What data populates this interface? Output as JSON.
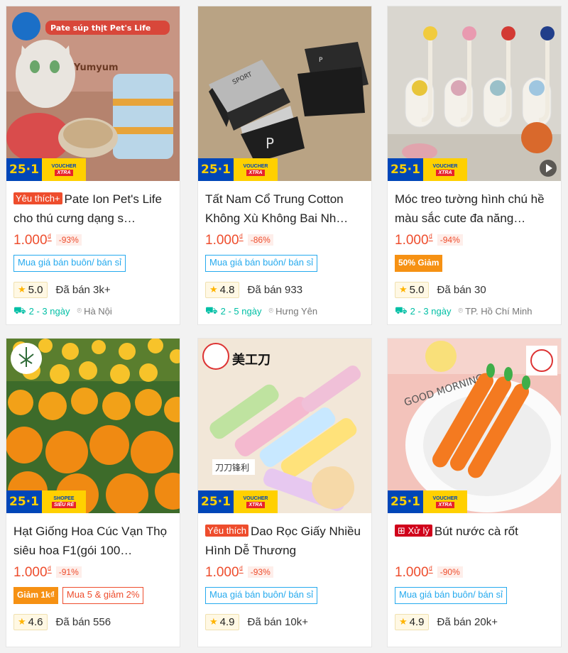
{
  "products": [
    {
      "id": "p1",
      "image_desc": "cat food pate cans",
      "image_text": [
        "Pate súp thịt Pet's Life",
        "Yumyum"
      ],
      "promo_badge": {
        "number": "25·1",
        "label": "VOUCHER",
        "extra": "XTRA"
      },
      "title_tag": "Yêu thích+",
      "title": "Pate Ion Pet's Life cho thú cưng dạng s…",
      "price": "1.000",
      "currency": "₫",
      "discount": "-93%",
      "tags": [
        {
          "type": "outline",
          "text": "Mua giá bán buôn/ bán sỉ"
        }
      ],
      "rating": "5.0",
      "sold": "Đã bán 3k+",
      "ship_days": "2 - 3 ngày",
      "location": "Hà Nội"
    },
    {
      "id": "p2",
      "image_desc": "folded socks",
      "image_text": [
        "SPORT"
      ],
      "promo_badge": {
        "number": "25·1",
        "label": "VOUCHER",
        "extra": "XTRA"
      },
      "title_tag": "",
      "title": "Tất Nam Cổ Trung Cotton Không Xù Không Bai Nh…",
      "price": "1.000",
      "currency": "₫",
      "discount": "-86%",
      "tags": [
        {
          "type": "outline",
          "text": "Mua giá bán buôn/ bán sỉ"
        }
      ],
      "rating": "4.8",
      "sold": "Đã bán 933",
      "ship_days": "2 - 5 ngày",
      "location": "Hưng Yên"
    },
    {
      "id": "p3",
      "image_desc": "wall hooks",
      "image_text": [],
      "promo_badge": {
        "number": "25·1",
        "label": "VOUCHER",
        "extra": "XTRA"
      },
      "title_tag": "",
      "title": "Móc treo tường hình chú hề màu sắc cute đa năng…",
      "price": "1.000",
      "currency": "₫",
      "discount": "-94%",
      "tags": [
        {
          "type": "orange",
          "text": "50% Giảm"
        }
      ],
      "rating": "5.0",
      "sold": "Đã bán 30",
      "ship_days": "2 - 3 ngày",
      "location": "TP. Hồ Chí Minh",
      "has_video": true
    },
    {
      "id": "p4",
      "image_desc": "marigold flowers",
      "image_text": [],
      "promo_badge": {
        "number": "25·1",
        "label": "SHOPEE",
        "extra": "SIÊU RẺ"
      },
      "title_tag": "",
      "title": "Hạt Giống Hoa Cúc Vạn Thọ siêu hoa F1(gói 100…",
      "price": "1.000",
      "currency": "₫",
      "discount": "-91%",
      "tags": [
        {
          "type": "orange",
          "text": "Giảm 1k₫"
        },
        {
          "type": "red-outline",
          "text": "Mua 5 & giảm 2%"
        }
      ],
      "rating": "4.6",
      "sold": "Đã bán 556",
      "ship_days": "",
      "location": ""
    },
    {
      "id": "p5",
      "image_desc": "cute box cutters",
      "image_text": [
        "美工刀",
        "刀刀锋利"
      ],
      "promo_badge": {
        "number": "25·1",
        "label": "VOUCHER",
        "extra": "XTRA"
      },
      "title_tag": "Yêu thích",
      "title": "Dao Rọc Giấy Nhiều Hình Dễ Thương",
      "price": "1.000",
      "currency": "₫",
      "discount": "-93%",
      "tags": [
        {
          "type": "outline",
          "text": "Mua giá bán buôn/ bán sỉ"
        }
      ],
      "rating": "4.9",
      "sold": "Đã bán 10k+",
      "ship_days": "",
      "location": ""
    },
    {
      "id": "p6",
      "image_desc": "carrot pens",
      "image_text": [
        "GOOD MORNING"
      ],
      "promo_badge": {
        "number": "25·1",
        "label": "VOUCHER",
        "extra": "XTRA"
      },
      "title_tag": "Xử lý",
      "title": "Bút nước cà rốt",
      "price": "1.000",
      "currency": "₫",
      "discount": "-90%",
      "tags": [
        {
          "type": "outline",
          "text": "Mua giá bán buôn/ bán sỉ"
        }
      ],
      "rating": "4.9",
      "sold": "Đã bán 20k+",
      "ship_days": "",
      "location": ""
    }
  ],
  "colors": {
    "accent": "#ee4d2d",
    "teal": "#00bfa5",
    "blue_tag": "#26aaee",
    "badge_blue": "#0046b8",
    "badge_yellow": "#ffd000"
  }
}
